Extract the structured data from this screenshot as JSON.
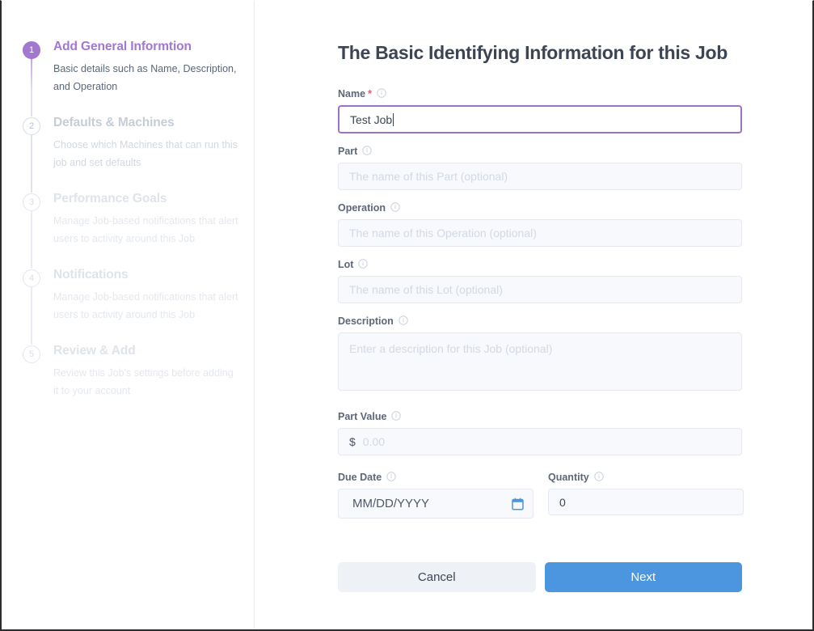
{
  "sidebar": {
    "steps": [
      {
        "number": "1",
        "title": "Add General Informtion",
        "description": "Basic details such as Name, Description, and Operation",
        "state": "active"
      },
      {
        "number": "2",
        "title": "Defaults & Machines",
        "description": "Choose which Machines that can run this job and set defaults",
        "state": "upcoming"
      },
      {
        "number": "3",
        "title": "Performance Goals",
        "description": "Manage Job-based notifications that alert users to activity around this Job",
        "state": "faded"
      },
      {
        "number": "4",
        "title": "Notifications",
        "description": "Manage Job-based notifications that alert users to activity around this Job",
        "state": "faded"
      },
      {
        "number": "5",
        "title": "Review & Add",
        "description": "Review this Job's settings before adding it to your account",
        "state": "faded"
      }
    ]
  },
  "main": {
    "title": "The Basic Identifying Information for this Job",
    "fields": {
      "name": {
        "label": "Name",
        "required_marker": "*",
        "value": "Test Job",
        "info_icon": "info-circle-icon"
      },
      "part": {
        "label": "Part",
        "value": "",
        "placeholder": "The name of this Part (optional)",
        "info_icon": "info-circle-icon"
      },
      "operation": {
        "label": "Operation",
        "value": "",
        "placeholder": "The name of this Operation (optional)",
        "info_icon": "info-circle-icon"
      },
      "lot": {
        "label": "Lot",
        "value": "",
        "placeholder": "The name of this Lot (optional)",
        "info_icon": "info-circle-icon"
      },
      "description": {
        "label": "Description",
        "value": "",
        "placeholder": "Enter a description for this Job (optional)",
        "info_icon": "info-circle-icon"
      },
      "part_value": {
        "label": "Part Value",
        "currency_symbol": "$",
        "value": "",
        "placeholder": "0.00",
        "info_icon": "info-circle-icon"
      },
      "due_date": {
        "label": "Due Date",
        "value": "MM/DD/YYYY",
        "info_icon": "info-circle-icon",
        "picker_icon": "calendar-icon"
      },
      "quantity": {
        "label": "Quantity",
        "value": "0",
        "info_icon": "info-circle-icon"
      }
    },
    "buttons": {
      "cancel": "Cancel",
      "next": "Next"
    }
  },
  "colors": {
    "accent_purple": "#a277cf",
    "focus_border": "#9b73c6",
    "primary_blue": "#4b96df",
    "required_red": "#e8596b",
    "heading": "#3d4554",
    "field_bg": "#f7f9fc",
    "calendar_icon": "#4b96df"
  }
}
